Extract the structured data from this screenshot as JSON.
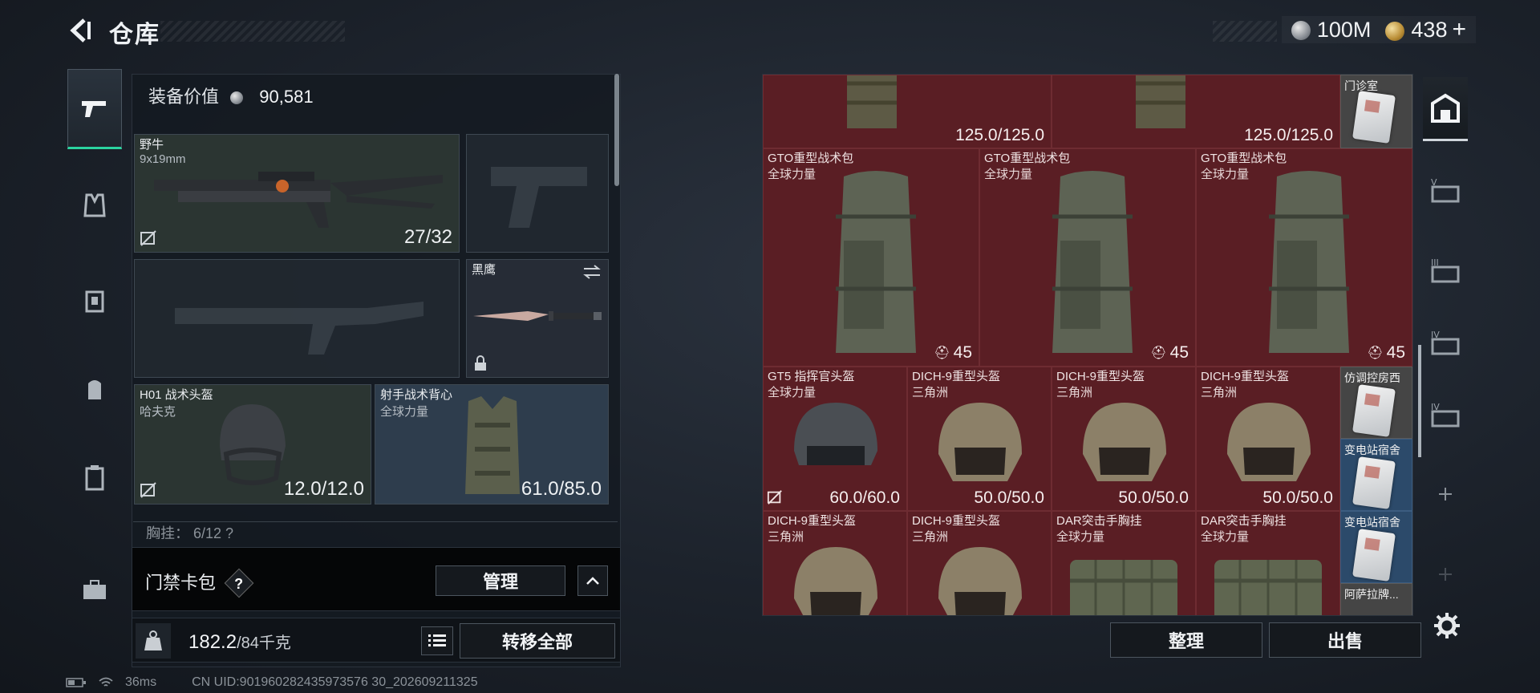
{
  "header": {
    "title": "仓库"
  },
  "currency": {
    "silver": "100M",
    "gold": "438",
    "plus": "+"
  },
  "equipment": {
    "value_label": "装备价值",
    "value": "90,581",
    "primary_weapon": {
      "name": "野牛",
      "caliber": "9x19mm",
      "ammo": "27/32"
    },
    "melee": {
      "name": "黑鹰"
    },
    "helmet": {
      "name": "H01 战术头盔",
      "maker": "哈夫克",
      "durability": "12.0/12.0"
    },
    "armor": {
      "name": "射手战术背心",
      "maker": "全球力量",
      "durability": "61.0/85.0"
    },
    "chest_rig": {
      "label": "胸挂： 6/12 ?"
    }
  },
  "card_bag": {
    "label": "门禁卡包",
    "help": "?",
    "manage": "管理"
  },
  "weight": {
    "current": "182.2",
    "capacity": "/84千克"
  },
  "transfer_all": "转移全部",
  "storage": {
    "top_row": [
      {
        "val": "125.0/125.0"
      },
      {
        "val": "125.0/125.0"
      }
    ],
    "backpacks": [
      {
        "name": "GTO重型战术包",
        "maker": "全球力量",
        "count": "45"
      },
      {
        "name": "GTO重型战术包",
        "maker": "全球力量",
        "count": "45"
      },
      {
        "name": "GTO重型战术包",
        "maker": "全球力量",
        "count": "45"
      }
    ],
    "helmets": [
      {
        "name": "GT5 指挥官头盔",
        "maker": "全球力量",
        "val": "60.0/60.0"
      },
      {
        "name": "DICH-9重型头盔",
        "maker": "三角洲",
        "val": "50.0/50.0"
      },
      {
        "name": "DICH-9重型头盔",
        "maker": "三角洲",
        "val": "50.0/50.0"
      },
      {
        "name": "DICH-9重型头盔",
        "maker": "三角洲",
        "val": "50.0/50.0"
      }
    ],
    "bottom_row": [
      {
        "name": "DICH-9重型头盔",
        "maker": "三角洲"
      },
      {
        "name": "DICH-9重型头盔",
        "maker": "三角洲"
      },
      {
        "name": "DAR突击手胸挂",
        "maker": "全球力量"
      },
      {
        "name": "DAR突击手胸挂",
        "maker": "全球力量"
      }
    ],
    "cards": [
      {
        "name": "门诊室"
      },
      {
        "name": "仿调控房西"
      },
      {
        "name": "变电站宿舍"
      },
      {
        "name": "变电站宿舍"
      },
      {
        "name": "阿萨拉牌..."
      }
    ]
  },
  "buttons": {
    "sort": "整理",
    "sell": "出售"
  },
  "status": {
    "ping": "36ms",
    "uid": "CN UID:901960282435973576 30_202609211325"
  },
  "colors": {
    "accent": "#2bd4a0",
    "cell_red": "#5a1e24",
    "card_blue": "#2c4a6a"
  }
}
